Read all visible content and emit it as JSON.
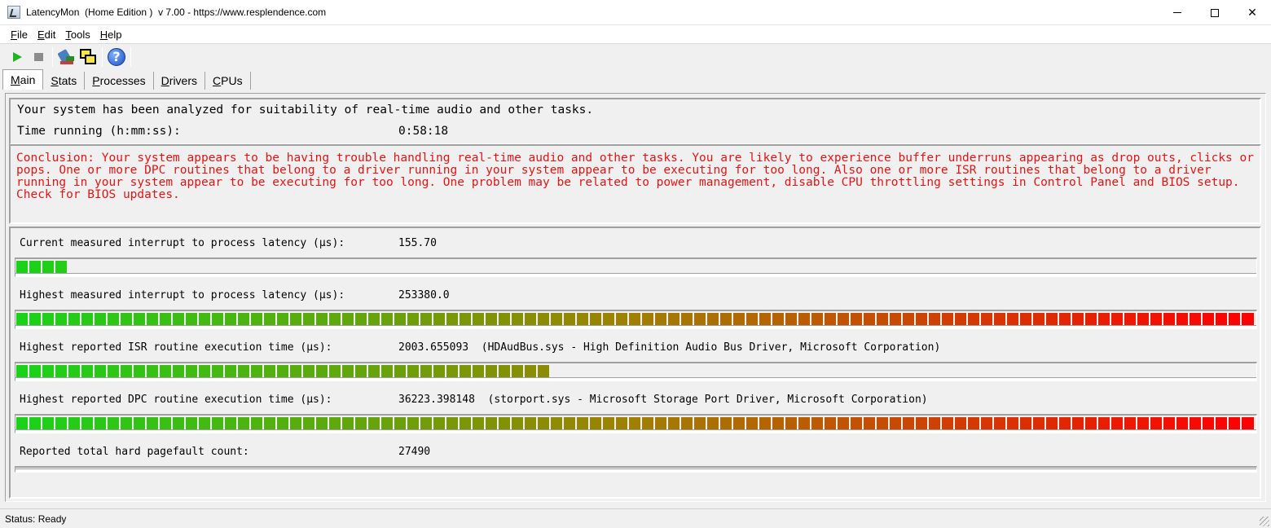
{
  "window": {
    "title": "LatencyMon  (Home Edition )  v 7.00 - https://www.resplendence.com",
    "minimize_label": "",
    "maximize_label": "",
    "close_label": "✕"
  },
  "menu": {
    "items": [
      {
        "label": "File",
        "accel": "F",
        "rest": "ile"
      },
      {
        "label": "Edit",
        "accel": "E",
        "rest": "dit"
      },
      {
        "label": "Tools",
        "accel": "T",
        "rest": "ools"
      },
      {
        "label": "Help",
        "accel": "H",
        "rest": "elp"
      }
    ]
  },
  "toolbar": {
    "icons": [
      "play-icon",
      "stop-icon",
      "tool-icon",
      "windows-icon",
      "help-icon"
    ]
  },
  "tabs": [
    {
      "label": "Main",
      "accel": "M",
      "rest": "ain",
      "active": true
    },
    {
      "label": "Stats",
      "accel": "S",
      "rest": "tats",
      "active": false
    },
    {
      "label": "Processes",
      "accel": "P",
      "rest": "rocesses",
      "active": false
    },
    {
      "label": "Drivers",
      "accel": "D",
      "rest": "rivers",
      "active": false
    },
    {
      "label": "CPUs",
      "accel": "C",
      "rest": "PUs",
      "active": false
    }
  ],
  "summary": {
    "analyzed_text": "Your system has been analyzed for suitability of real-time audio and other tasks.",
    "time_label": "Time running (h:mm:ss):",
    "time_value": "0:58:18"
  },
  "conclusion": {
    "text": "Conclusion: Your system appears to be having trouble handling real-time audio and other tasks. You are likely to experience buffer underruns appearing as drop outs, clicks or pops. One or more DPC routines that belong to a driver running in your system appear to be executing for too long. Also one or more ISR routines that belong to a driver running in your system appear to be executing for too long. One problem may be related to power management, disable CPU throttling settings in Control Panel and BIOS setup. Check for BIOS updates.",
    "color": "#e31414"
  },
  "metrics": [
    {
      "label": "Current measured interrupt to process latency (µs):",
      "value": "155.70",
      "level": 0.04
    },
    {
      "label": "Highest measured interrupt to process latency (µs):",
      "value": "253380.0",
      "level": 1.0
    },
    {
      "label": "Highest reported ISR routine execution time (µs):",
      "value": "2003.655093  (HDAudBus.sys - High Definition Audio Bus Driver, Microsoft Corporation)",
      "level": 0.43
    },
    {
      "label": "Highest reported DPC routine execution time (µs):",
      "value": "36223.398148  (storport.sys - Microsoft Storage Port Driver, Microsoft Corporation)",
      "level": 1.0
    },
    {
      "label": "Reported total hard pagefault count:",
      "value": "27490",
      "level": 0
    }
  ],
  "bar_colors": {
    "low": "#19d319",
    "mid": "#a08000",
    "high": "#ff0000"
  },
  "status": {
    "text": "Status: Ready"
  }
}
